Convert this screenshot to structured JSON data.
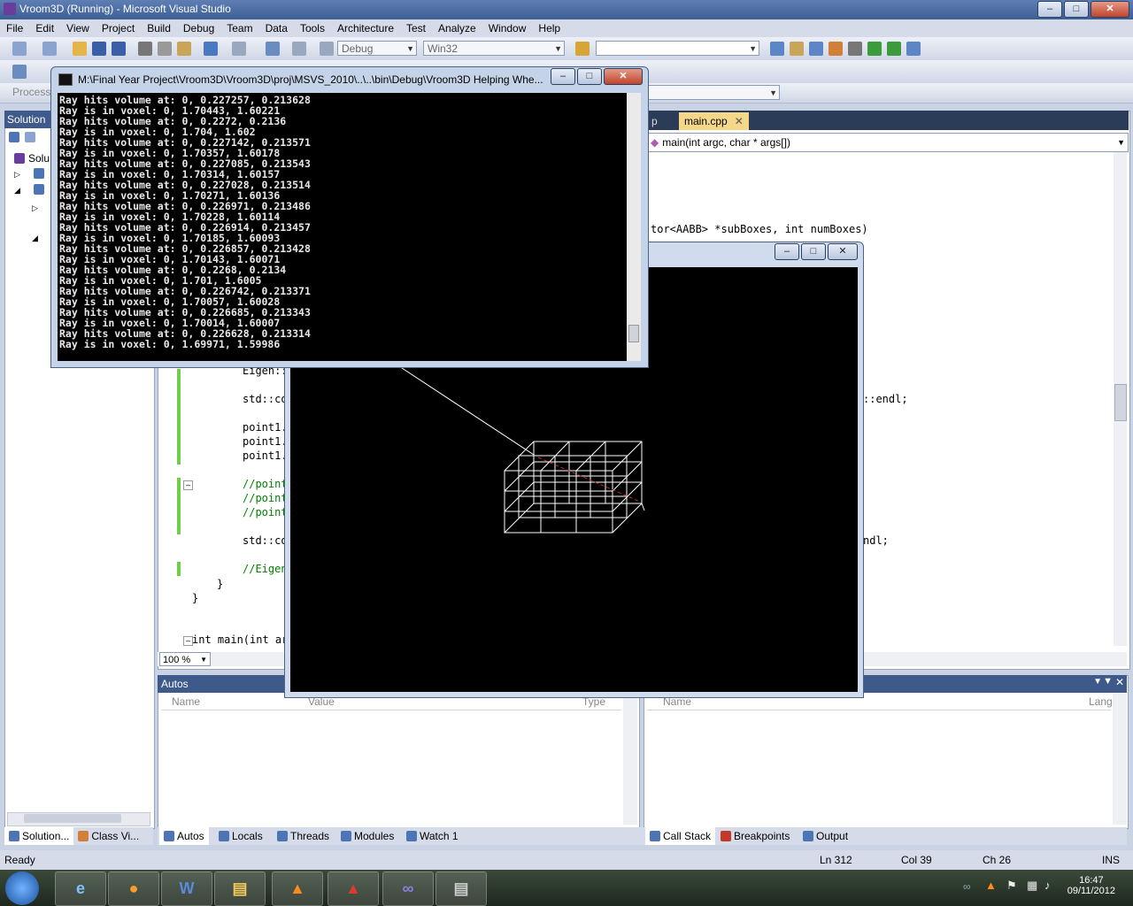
{
  "window": {
    "title": "Vroom3D (Running) - Microsoft Visual Studio"
  },
  "menu": [
    "File",
    "Edit",
    "View",
    "Project",
    "Build",
    "Debug",
    "Team",
    "Data",
    "Tools",
    "Architecture",
    "Test",
    "Analyze",
    "Window",
    "Help"
  ],
  "toolbar": {
    "config": "Debug",
    "platform": "Win32",
    "process_label": "Process"
  },
  "solution_explorer": {
    "title": "Solution",
    "root": "Solu",
    "tabs": [
      "Solution...",
      "Class Vi..."
    ]
  },
  "editor": {
    "tabs": [
      "p",
      "main.cpp"
    ],
    "active_tab": "main.cpp",
    "nav_member": "main(int argc, char * args[])",
    "zoom": "100 %",
    "code_signature_frag": "tor<AABB> *subBoxes, int numBoxes)",
    "lines": [
      "Eigen::",
      "std::co",
      "point1.",
      "point1.",
      "point1.",
      "//point",
      "//point",
      "//point",
      "std::co",
      "//Eigen",
      "}",
      "}",
      "int main(int ar"
    ],
    "right_frags": [
      "::endl;",
      "ndl;"
    ]
  },
  "console": {
    "title": "M:\\Final Year Project\\Vroom3D\\Vroom3D\\proj\\MSVS_2010\\..\\..\\bin\\Debug\\Vroom3D Helping Whe...",
    "lines": [
      "Ray hits volume at: 0, 0.227257, 0.213628",
      "Ray is in voxel: 0, 1.70443, 1.60221",
      "Ray hits volume at: 0, 0.2272, 0.2136",
      "Ray is in voxel: 0, 1.704, 1.602",
      "Ray hits volume at: 0, 0.227142, 0.213571",
      "Ray is in voxel: 0, 1.70357, 1.60178",
      "Ray hits volume at: 0, 0.227085, 0.213543",
      "Ray is in voxel: 0, 1.70314, 1.60157",
      "Ray hits volume at: 0, 0.227028, 0.213514",
      "Ray is in voxel: 0, 1.70271, 1.60136",
      "Ray hits volume at: 0, 0.226971, 0.213486",
      "Ray is in voxel: 0, 1.70228, 1.60114",
      "Ray hits volume at: 0, 0.226914, 0.213457",
      "Ray is in voxel: 0, 1.70185, 1.60093",
      "Ray hits volume at: 0, 0.226857, 0.213428",
      "Ray is in voxel: 0, 1.70143, 1.60071",
      "Ray hits volume at: 0, 0.2268, 0.2134",
      "Ray is in voxel: 0, 1.701, 1.6005",
      "Ray hits volume at: 0, 0.226742, 0.213371",
      "Ray is in voxel: 0, 1.70057, 1.60028",
      "Ray hits volume at: 0, 0.226685, 0.213343",
      "Ray is in voxel: 0, 1.70014, 1.60007",
      "Ray hits volume at: 0, 0.226628, 0.213314",
      "Ray is in voxel: 0, 1.69971, 1.59986"
    ]
  },
  "autos": {
    "title": "Autos",
    "columns": [
      "Name",
      "Value",
      "Type"
    ]
  },
  "callstack": {
    "columns": [
      "Name",
      "Lang"
    ]
  },
  "bottom_tabs_left": [
    "Autos",
    "Locals",
    "Threads",
    "Modules",
    "Watch 1"
  ],
  "bottom_tabs_right": [
    "Call Stack",
    "Breakpoints",
    "Output"
  ],
  "status": {
    "state": "Ready",
    "ln": "Ln 312",
    "col": "Col 39",
    "ch": "Ch 26",
    "mode": "INS"
  },
  "taskbar": {
    "time": "16:47",
    "date": "09/11/2012"
  }
}
